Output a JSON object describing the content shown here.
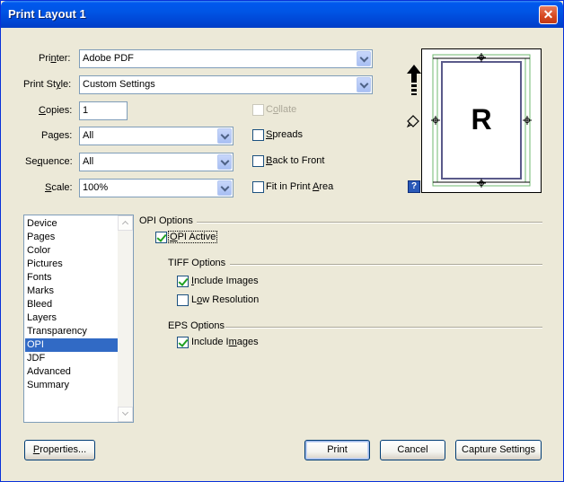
{
  "window": {
    "title": "Print Layout 1",
    "close_glyph": "✕"
  },
  "fields": {
    "printer": {
      "label_pre": "Pri",
      "label_key": "n",
      "label_post": "ter:",
      "value": "Adobe PDF"
    },
    "print_style": {
      "label_pre": "Print St",
      "label_key": "y",
      "label_post": "le:",
      "value": "Custom Settings"
    },
    "copies": {
      "label_key": "C",
      "label_post": "opies:",
      "value": "1"
    },
    "pages": {
      "label_pre": "Pa",
      "label_key": "g",
      "label_post": "es:",
      "value": "All"
    },
    "sequence": {
      "label_pre": "Se",
      "label_key": "q",
      "label_post": "uence:",
      "value": "All"
    },
    "scale": {
      "label_key": "S",
      "label_post": "cale:",
      "value": "100%"
    }
  },
  "checkboxes": {
    "collate": {
      "label_pre": "C",
      "label_key": "o",
      "label_post": "llate",
      "checked": false,
      "disabled": true
    },
    "spreads": {
      "label_pre": "",
      "label_key": "S",
      "label_post": "preads",
      "checked": false
    },
    "back_to_front": {
      "label_key": "B",
      "label_post": "ack to Front",
      "checked": false
    },
    "fit_in_print_area": {
      "label_pre": "Fit in Print ",
      "label_key": "A",
      "label_post": "rea",
      "checked": false
    }
  },
  "preview": {
    "letter": "R",
    "help_glyph": "?"
  },
  "sidebar": {
    "items": [
      "Device",
      "Pages",
      "Color",
      "Pictures",
      "Fonts",
      "Marks",
      "Bleed",
      "Layers",
      "Transparency",
      "OPI",
      "JDF",
      "Advanced",
      "Summary"
    ],
    "selected": "OPI"
  },
  "opi": {
    "group_title": "OPI Options",
    "opi_active": {
      "label_key": "O",
      "label_post": "PI Active",
      "checked": true
    },
    "tiff_title": "TIFF Options",
    "tiff_include_images": {
      "label_pre": "",
      "label_key": "I",
      "label_post": "nclude Images",
      "checked": true
    },
    "tiff_low_resolution": {
      "label_pre": "L",
      "label_key": "o",
      "label_post": "w Resolution",
      "checked": false
    },
    "eps_title": "EPS Options",
    "eps_include_images": {
      "label_pre": "Include I",
      "label_key": "m",
      "label_post": "ages",
      "checked": true
    }
  },
  "buttons": {
    "properties": {
      "label_key": "P",
      "label_post": "roperties..."
    },
    "print": "Print",
    "cancel": "Cancel",
    "capture_settings": "Capture Settings"
  },
  "colors": {
    "selection": "#316ac5",
    "titlebar": "#0055e5",
    "check": "#21a121"
  }
}
